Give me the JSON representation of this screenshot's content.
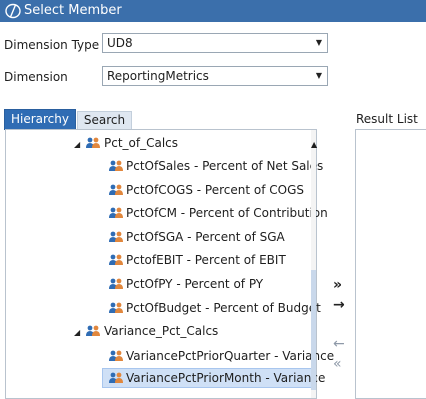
{
  "window": {
    "title": "Select Member"
  },
  "fields": {
    "dimension_type": {
      "label": "Dimension Type",
      "value": "UD8"
    },
    "dimension": {
      "label": "Dimension",
      "value": "ReportingMetrics"
    }
  },
  "tabs": [
    {
      "label": "Hierarchy"
    },
    {
      "label": "Search"
    }
  ],
  "result_list": {
    "label": "Result List"
  },
  "tree": {
    "items": [
      {
        "label": "Pct_of_Calcs"
      },
      {
        "label": "PctOfSales - Percent of Net Sales"
      },
      {
        "label": "PctOfCOGS - Percent of COGS"
      },
      {
        "label": "PctOfCM - Percent of Contribution"
      },
      {
        "label": "PctOfSGA - Percent of SGA"
      },
      {
        "label": "PctofEBIT - Percent of EBIT"
      },
      {
        "label": "PctOfPY - Percent of PY"
      },
      {
        "label": "PctOfBudget - Percent of Budget"
      },
      {
        "label": "Variance_Pct_Calcs"
      },
      {
        "label": "VariancePctPriorQuarter - Variance"
      },
      {
        "label": "VariancePctPriorMonth - Variance"
      }
    ]
  },
  "colors": {
    "titlebar": "#3b6fab",
    "tab_active": "#2f6cb4",
    "selection": "#cfe0f6"
  }
}
